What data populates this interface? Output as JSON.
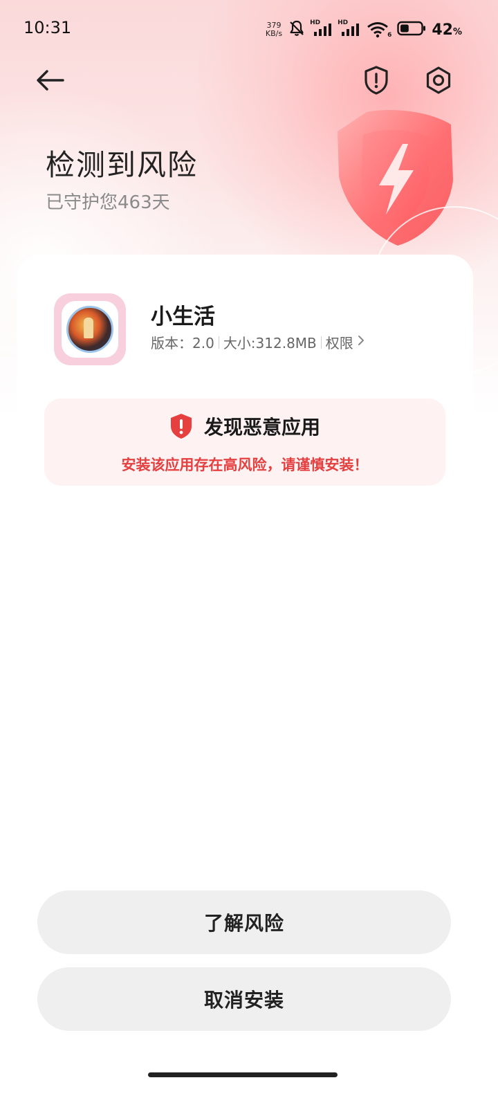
{
  "status_bar": {
    "time": "10:31",
    "net_speed_value": "379",
    "net_speed_unit": "KB/s",
    "hd_label": "HD",
    "wifi_badge": "6",
    "battery_percent": "42",
    "battery_unit": "%",
    "battery_level": 0.42
  },
  "nav": {
    "back_icon": "arrow-left-icon",
    "shield_icon": "shield-alert-icon",
    "settings_icon": "gear-icon"
  },
  "hero": {
    "title": "检测到风险",
    "subtitle": "已守护您463天"
  },
  "app": {
    "name": "小生活",
    "version": "版本：2.0",
    "size": "大小:312.8MB",
    "permissions": "权限"
  },
  "warning": {
    "title": "发现恶意应用",
    "description": "安装该应用存在高风险，请谨慎安装！"
  },
  "actions": {
    "learn_risk": "了解风险",
    "cancel_install": "取消安装"
  },
  "colors": {
    "accent_red": "#e5403f",
    "warn_bg": "#fff2f3",
    "button_bg": "#efefef"
  }
}
